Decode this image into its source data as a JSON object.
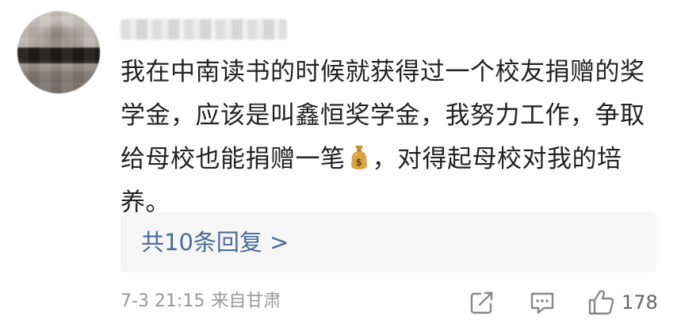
{
  "comment": {
    "text_before_icon": "我在中南读书的时候就获得过一个校友捐赠的奖学金，应该是叫鑫恒奖学金，我努力工作，争取给母校也能捐赠一笔",
    "text_after_icon": "，对得起母校对我的培养。",
    "inline_icon": "money-bag-icon"
  },
  "replies": {
    "label": "共10条回复 >"
  },
  "footer": {
    "date_time": "7-3 21:15",
    "location": "来自甘肃"
  },
  "actions": {
    "share_icon": "share-icon",
    "reply_icon": "comment-icon",
    "like_icon": "thumbs-up-icon",
    "like_count": "178"
  },
  "colors": {
    "text": "#222222",
    "link": "#4b6c98",
    "meta": "#999999",
    "reply_bg": "#f6f6f6"
  }
}
